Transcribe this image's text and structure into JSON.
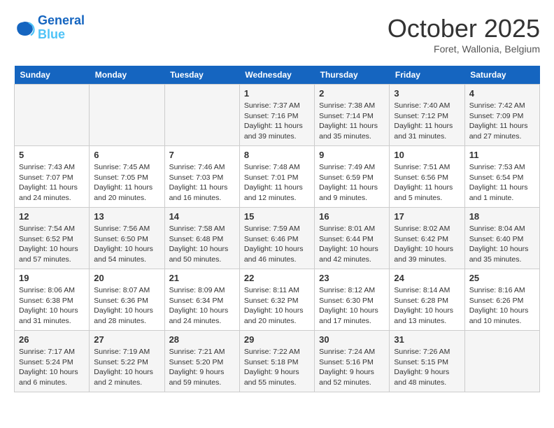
{
  "logo": {
    "line1": "General",
    "line2": "Blue"
  },
  "title": "October 2025",
  "location": "Foret, Wallonia, Belgium",
  "weekdays": [
    "Sunday",
    "Monday",
    "Tuesday",
    "Wednesday",
    "Thursday",
    "Friday",
    "Saturday"
  ],
  "weeks": [
    [
      {
        "day": "",
        "info": ""
      },
      {
        "day": "",
        "info": ""
      },
      {
        "day": "",
        "info": ""
      },
      {
        "day": "1",
        "info": "Sunrise: 7:37 AM\nSunset: 7:16 PM\nDaylight: 11 hours\nand 39 minutes."
      },
      {
        "day": "2",
        "info": "Sunrise: 7:38 AM\nSunset: 7:14 PM\nDaylight: 11 hours\nand 35 minutes."
      },
      {
        "day": "3",
        "info": "Sunrise: 7:40 AM\nSunset: 7:12 PM\nDaylight: 11 hours\nand 31 minutes."
      },
      {
        "day": "4",
        "info": "Sunrise: 7:42 AM\nSunset: 7:09 PM\nDaylight: 11 hours\nand 27 minutes."
      }
    ],
    [
      {
        "day": "5",
        "info": "Sunrise: 7:43 AM\nSunset: 7:07 PM\nDaylight: 11 hours\nand 24 minutes."
      },
      {
        "day": "6",
        "info": "Sunrise: 7:45 AM\nSunset: 7:05 PM\nDaylight: 11 hours\nand 20 minutes."
      },
      {
        "day": "7",
        "info": "Sunrise: 7:46 AM\nSunset: 7:03 PM\nDaylight: 11 hours\nand 16 minutes."
      },
      {
        "day": "8",
        "info": "Sunrise: 7:48 AM\nSunset: 7:01 PM\nDaylight: 11 hours\nand 12 minutes."
      },
      {
        "day": "9",
        "info": "Sunrise: 7:49 AM\nSunset: 6:59 PM\nDaylight: 11 hours\nand 9 minutes."
      },
      {
        "day": "10",
        "info": "Sunrise: 7:51 AM\nSunset: 6:56 PM\nDaylight: 11 hours\nand 5 minutes."
      },
      {
        "day": "11",
        "info": "Sunrise: 7:53 AM\nSunset: 6:54 PM\nDaylight: 11 hours\nand 1 minute."
      }
    ],
    [
      {
        "day": "12",
        "info": "Sunrise: 7:54 AM\nSunset: 6:52 PM\nDaylight: 10 hours\nand 57 minutes."
      },
      {
        "day": "13",
        "info": "Sunrise: 7:56 AM\nSunset: 6:50 PM\nDaylight: 10 hours\nand 54 minutes."
      },
      {
        "day": "14",
        "info": "Sunrise: 7:58 AM\nSunset: 6:48 PM\nDaylight: 10 hours\nand 50 minutes."
      },
      {
        "day": "15",
        "info": "Sunrise: 7:59 AM\nSunset: 6:46 PM\nDaylight: 10 hours\nand 46 minutes."
      },
      {
        "day": "16",
        "info": "Sunrise: 8:01 AM\nSunset: 6:44 PM\nDaylight: 10 hours\nand 42 minutes."
      },
      {
        "day": "17",
        "info": "Sunrise: 8:02 AM\nSunset: 6:42 PM\nDaylight: 10 hours\nand 39 minutes."
      },
      {
        "day": "18",
        "info": "Sunrise: 8:04 AM\nSunset: 6:40 PM\nDaylight: 10 hours\nand 35 minutes."
      }
    ],
    [
      {
        "day": "19",
        "info": "Sunrise: 8:06 AM\nSunset: 6:38 PM\nDaylight: 10 hours\nand 31 minutes."
      },
      {
        "day": "20",
        "info": "Sunrise: 8:07 AM\nSunset: 6:36 PM\nDaylight: 10 hours\nand 28 minutes."
      },
      {
        "day": "21",
        "info": "Sunrise: 8:09 AM\nSunset: 6:34 PM\nDaylight: 10 hours\nand 24 minutes."
      },
      {
        "day": "22",
        "info": "Sunrise: 8:11 AM\nSunset: 6:32 PM\nDaylight: 10 hours\nand 20 minutes."
      },
      {
        "day": "23",
        "info": "Sunrise: 8:12 AM\nSunset: 6:30 PM\nDaylight: 10 hours\nand 17 minutes."
      },
      {
        "day": "24",
        "info": "Sunrise: 8:14 AM\nSunset: 6:28 PM\nDaylight: 10 hours\nand 13 minutes."
      },
      {
        "day": "25",
        "info": "Sunrise: 8:16 AM\nSunset: 6:26 PM\nDaylight: 10 hours\nand 10 minutes."
      }
    ],
    [
      {
        "day": "26",
        "info": "Sunrise: 7:17 AM\nSunset: 5:24 PM\nDaylight: 10 hours\nand 6 minutes."
      },
      {
        "day": "27",
        "info": "Sunrise: 7:19 AM\nSunset: 5:22 PM\nDaylight: 10 hours\nand 2 minutes."
      },
      {
        "day": "28",
        "info": "Sunrise: 7:21 AM\nSunset: 5:20 PM\nDaylight: 9 hours\nand 59 minutes."
      },
      {
        "day": "29",
        "info": "Sunrise: 7:22 AM\nSunset: 5:18 PM\nDaylight: 9 hours\nand 55 minutes."
      },
      {
        "day": "30",
        "info": "Sunrise: 7:24 AM\nSunset: 5:16 PM\nDaylight: 9 hours\nand 52 minutes."
      },
      {
        "day": "31",
        "info": "Sunrise: 7:26 AM\nSunset: 5:15 PM\nDaylight: 9 hours\nand 48 minutes."
      },
      {
        "day": "",
        "info": ""
      }
    ]
  ]
}
